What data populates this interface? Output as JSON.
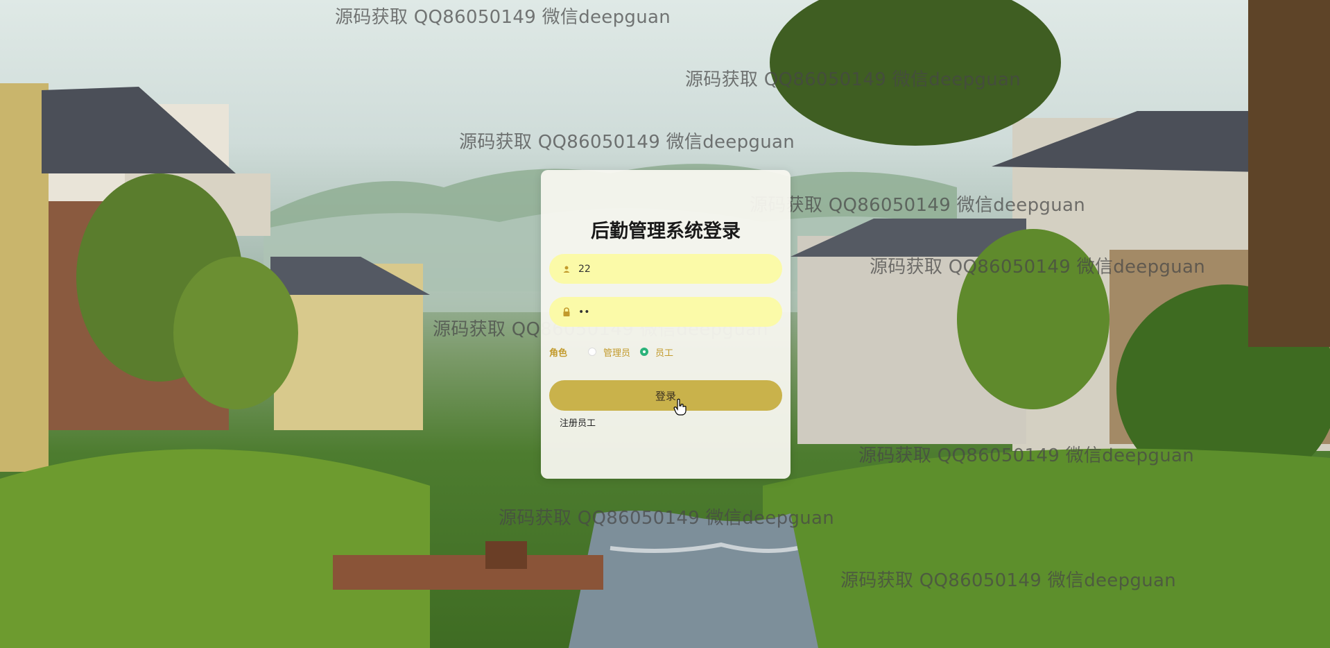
{
  "login": {
    "title": "后勤管理系统登录",
    "username_value": "22",
    "password_mask": "••",
    "role_label": "角色",
    "roles": [
      {
        "label": "管理员",
        "checked": false
      },
      {
        "label": "员工",
        "checked": true
      }
    ],
    "login_button_label": "登录",
    "register_link_label": "注册员工"
  },
  "watermarks": [
    "源码获取 QQ86050149 微信deepguan",
    "源码获取 QQ86050149 微信deepguan",
    "源码获取 QQ86050149 微信deepguan",
    "源码获取 QQ86050149 微信deepguan",
    "源码获取 QQ86050149 微信deepguan",
    "源码获取 QQ86050149 微信deepguan",
    "源码获取 QQ86050149 微信deepguan",
    "源码获取 QQ86050149 微信deepguan",
    "源码获取 QQ86050149 微信deepguan"
  ],
  "colors": {
    "input_bg": "#fbfaa8",
    "button_bg": "#c9b24b",
    "role_text": "#c29a2c",
    "radio_checked": "#2bb37a"
  },
  "icons": {
    "username": "user-icon",
    "password": "lock-icon"
  }
}
